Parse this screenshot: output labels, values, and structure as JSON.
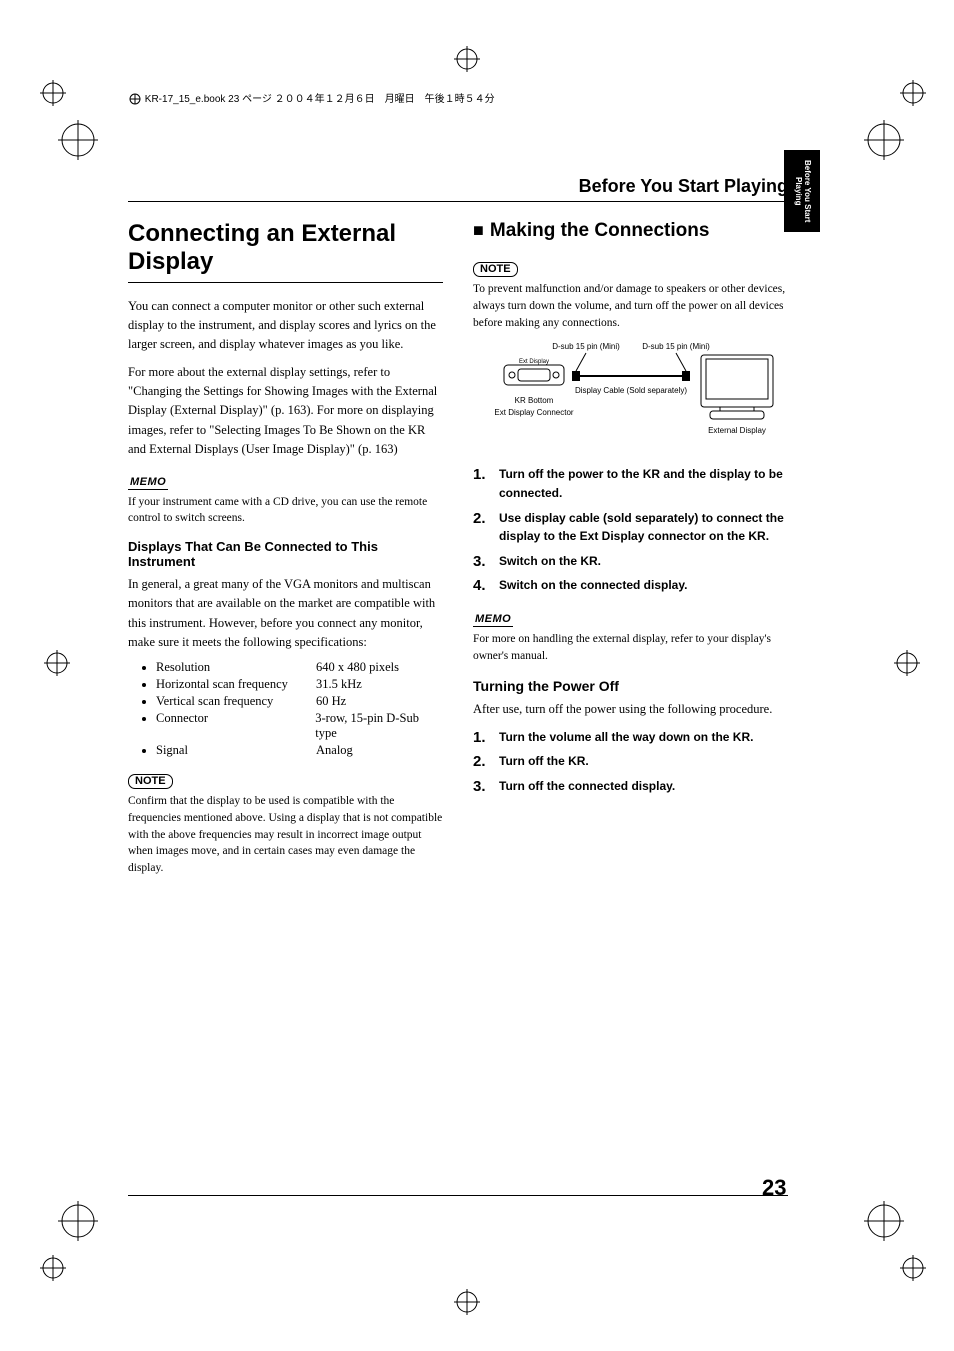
{
  "bookHeader": "KR-17_15_e.book 23 ページ ２００４年１２月６日　月曜日　午後１時５４分",
  "sectionHeader": "Before You Start Playing",
  "sideTab": "Before You Start Playing",
  "left": {
    "title": "Connecting an External Display",
    "p1": "You can connect a computer monitor or other such external display to the instrument, and display scores and lyrics on the larger screen, and display whatever images as you like.",
    "p2": "For more about the external display settings, refer to \"Changing the Settings for Showing Images with the External Display (External Display)\" (p. 163). For more on displaying images, refer to \"Selecting Images To Be Shown on the KR and External Displays (User Image Display)\" (p. 163)",
    "memoLabel": "MEMO",
    "memoText": "If your instrument came with a CD drive, you can use the remote control to switch screens.",
    "specsTitle": "Displays That Can Be Connected to This Instrument",
    "specsIntro": "In general, a great many of the VGA monitors and multiscan monitors that are available on the market are compatible with this instrument. However, before you connect any monitor, make sure it meets the following specifications:",
    "specs": [
      {
        "label": "Resolution",
        "value": "640 x 480 pixels"
      },
      {
        "label": "Horizontal scan frequency",
        "value": "31.5 kHz"
      },
      {
        "label": "Vertical scan frequency",
        "value": "60 Hz"
      },
      {
        "label": "Connector",
        "value": "3-row, 15-pin D-Sub type"
      },
      {
        "label": "Signal",
        "value": "Analog"
      }
    ],
    "noteLabel": "NOTE",
    "noteText": "Confirm that the display to be used is compatible with the frequencies mentioned above. Using a display that is not compatible with the above frequencies may result in incorrect image output when images move, and in certain cases may even damage the display."
  },
  "right": {
    "title": "Making the Connections",
    "noteLabel": "NOTE",
    "noteText": "To prevent malfunction and/or damage to speakers or other devices, always turn down the volume, and turn off the power on all devices before making any connections.",
    "diagram": {
      "dsub1": "D-sub 15 pin (Mini)",
      "dsub2": "D-sub 15 pin (Mini)",
      "extLabel": "Ext Display",
      "krBottom": "KR Bottom",
      "extConn": "Ext Display Connector",
      "cable": "Display Cable (Sold separately)",
      "extDisplay": "External Display"
    },
    "steps1": [
      "Turn off the power to the KR and the display to be connected.",
      "Use display cable (sold separately) to connect the display to the Ext Display connector on the KR.",
      "Switch on the KR.",
      "Switch on the connected display."
    ],
    "memoLabel": "MEMO",
    "memoText": "For more on handling the external display, refer to your display's owner's manual.",
    "sub2": "Turning the Power Off",
    "sub2Intro": "After use, turn off the power using the following procedure.",
    "steps2": [
      "Turn the volume all the way down on the KR.",
      "Turn off the KR.",
      "Turn off the connected display."
    ]
  },
  "pageNum": "23"
}
